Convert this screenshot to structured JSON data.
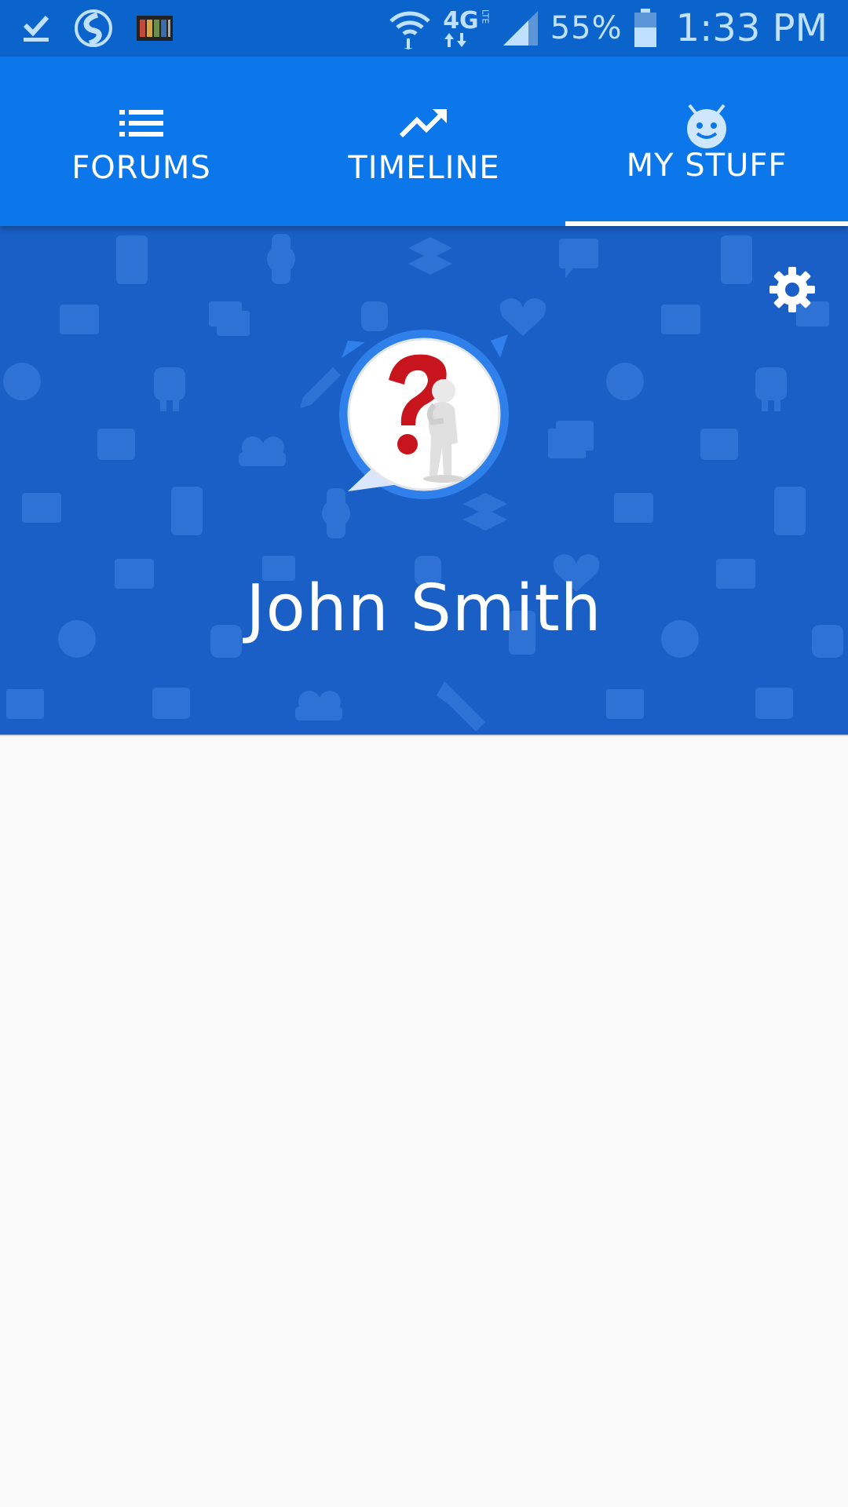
{
  "status_bar": {
    "left_icons": [
      "download-done-icon",
      "s-logo-icon",
      "film-strip-icon"
    ],
    "network": "4G",
    "network_sub": "LTE",
    "battery": "55%",
    "time": "1:33 PM"
  },
  "tabs": [
    {
      "label": "FORUMS",
      "icon": "list-icon",
      "active": false
    },
    {
      "label": "TIMELINE",
      "icon": "trending-up-icon",
      "active": false
    },
    {
      "label": "MY STUFF",
      "icon": "android-face-icon",
      "active": true
    }
  ],
  "profile": {
    "name": "John Smith",
    "avatar": "question-mark-person-avatar",
    "settings_icon": "gear-icon"
  },
  "colors": {
    "status_bar": "#0b63cc",
    "tab_bar": "#0c77ea",
    "header_bg": "#1a5fc6",
    "pattern": "#2d72d4",
    "body_bg": "#fafafa"
  }
}
